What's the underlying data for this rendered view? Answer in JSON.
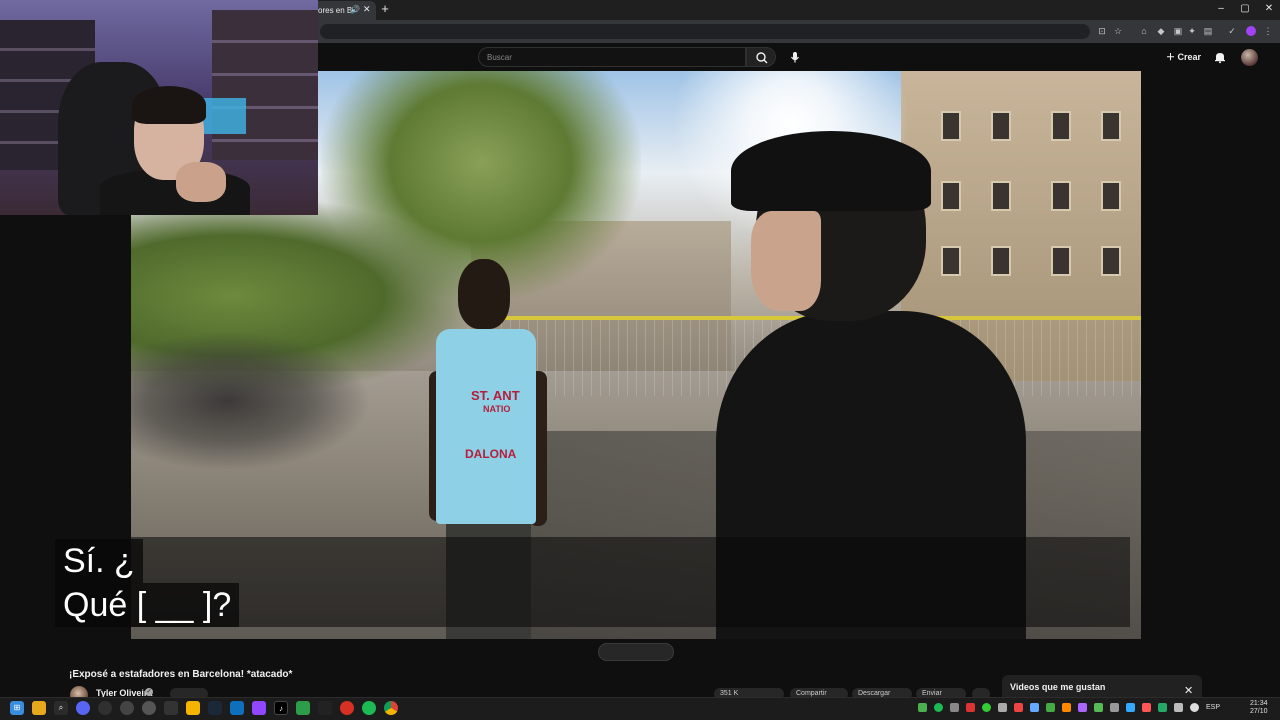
{
  "browser": {
    "tab_title": "ores en B",
    "tab_audio_icon": "speaker-icon",
    "new_tab_label": "+",
    "window_controls": [
      "–",
      "▢",
      "✕"
    ]
  },
  "youtube": {
    "search_placeholder": "Buscar",
    "create_label": "Crear"
  },
  "video": {
    "captions": [
      "Sí.   ¿",
      "Qué [ __ ]?"
    ],
    "jersey_text": [
      "ST. ANT",
      "NATIO",
      "DALONA"
    ]
  },
  "below_video": {
    "title": "¡Exposé a estafadores en Barcelona! *atacado*",
    "channel_name": "Tyler Oliveira",
    "actions": [
      "351 K",
      "Compartir",
      "Descargar",
      "Enviar"
    ]
  },
  "side_panel": {
    "title": "Videos que me gustan",
    "close_label": "✕"
  },
  "taskbar": {
    "language": "ESP",
    "time": "21:34",
    "date": "27/10"
  },
  "colors": {
    "youtube_bg": "#0f0f0f",
    "chrome_bar": "#35363a",
    "taskbar": "#1c1c1c"
  }
}
